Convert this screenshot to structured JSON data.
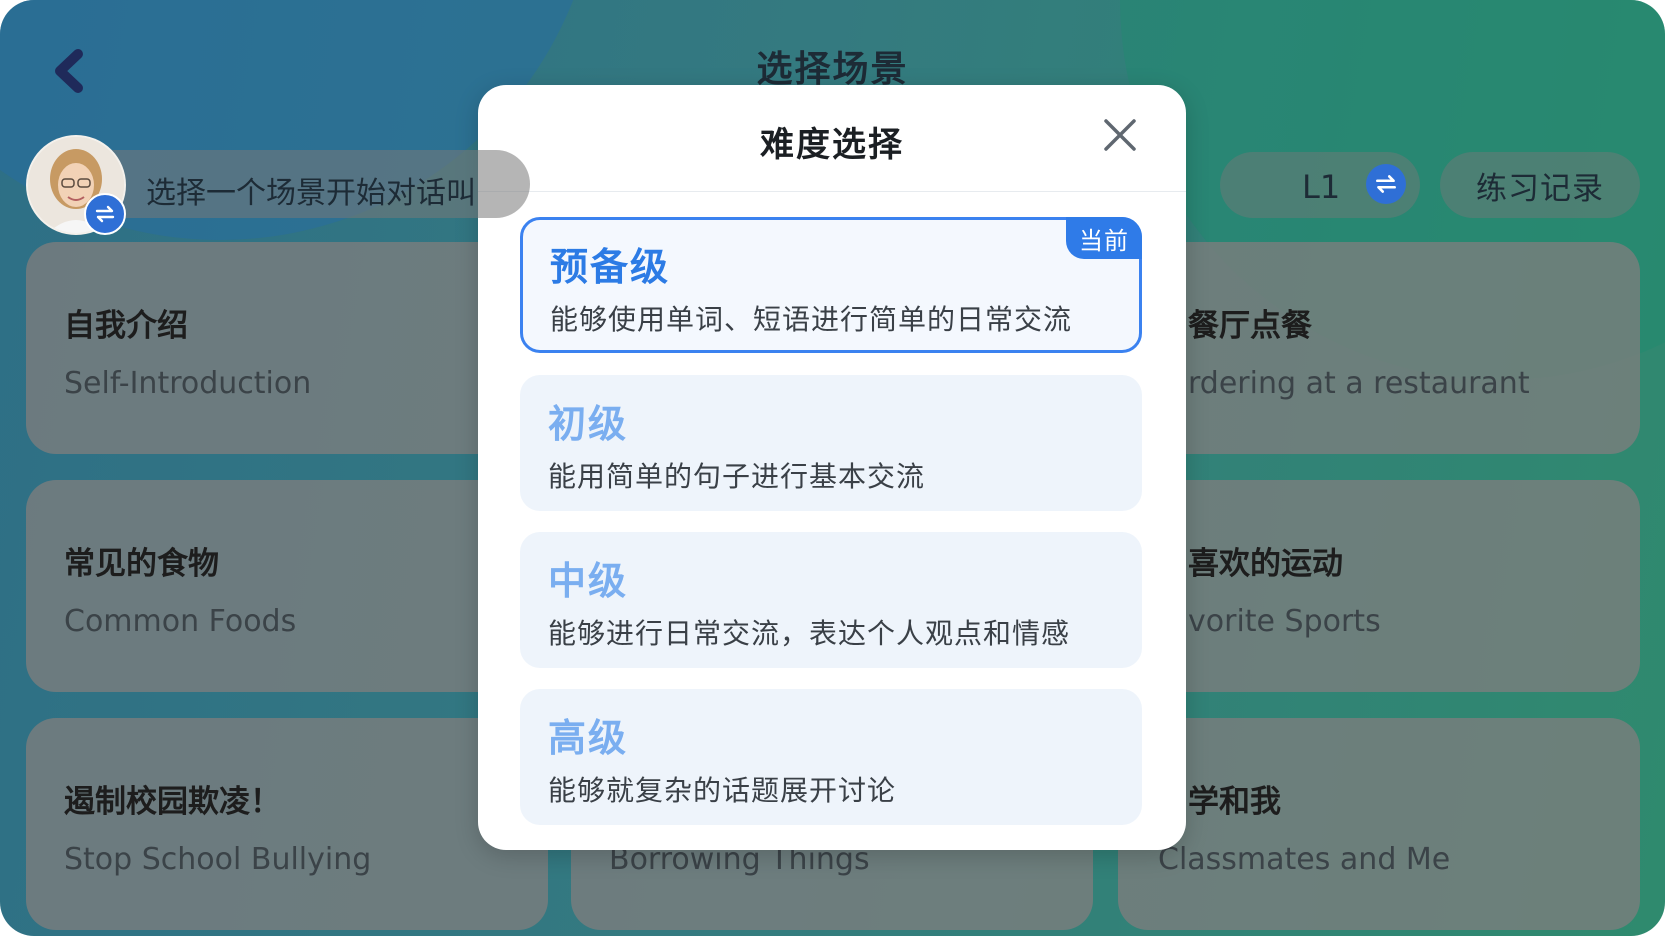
{
  "header": {
    "title": "选择场景",
    "back_icon": "chevron-left-icon"
  },
  "top_bar": {
    "prompt": "选择一个场景开始对话叫",
    "avatar_icon": "avatar-woman-icon",
    "avatar_switch_icon": "swap-icon",
    "level": "L1",
    "level_switch_icon": "swap-icon",
    "records_label": "练习记录"
  },
  "scenes": [
    {
      "title": "自我介绍",
      "subtitle": "Self-Introduction"
    },
    {
      "title": "餐厅点餐",
      "subtitle": "rdering at a restaurant"
    },
    {
      "title": "常见的食物",
      "subtitle": "Common Foods"
    },
    {
      "title": "喜欢的运动",
      "subtitle": "vorite Sports"
    },
    {
      "title": "遏制校园欺凌！",
      "subtitle": "Stop  School Bullying"
    },
    {
      "title": "",
      "subtitle": "Borrowing Things"
    },
    {
      "title": "学和我",
      "subtitle": "Classmates and Me"
    }
  ],
  "modal": {
    "title": "难度选择",
    "close_icon": "close-icon",
    "current_badge": "当前",
    "options": [
      {
        "title": "预备级",
        "desc": "能够使用单词、短语进行简单的日常交流",
        "current": true
      },
      {
        "title": "初级",
        "desc": "能用简单的句子进行基本交流",
        "current": false
      },
      {
        "title": "中级",
        "desc": "能够进行日常交流，表达个人观点和情感",
        "current": false
      },
      {
        "title": "高级",
        "desc": "能够就复杂的话题展开讨论",
        "current": false
      }
    ]
  },
  "colors": {
    "accent": "#2f7be8",
    "option_title_inactive": "#7aaef0",
    "option_bg": "#eef4fb"
  }
}
